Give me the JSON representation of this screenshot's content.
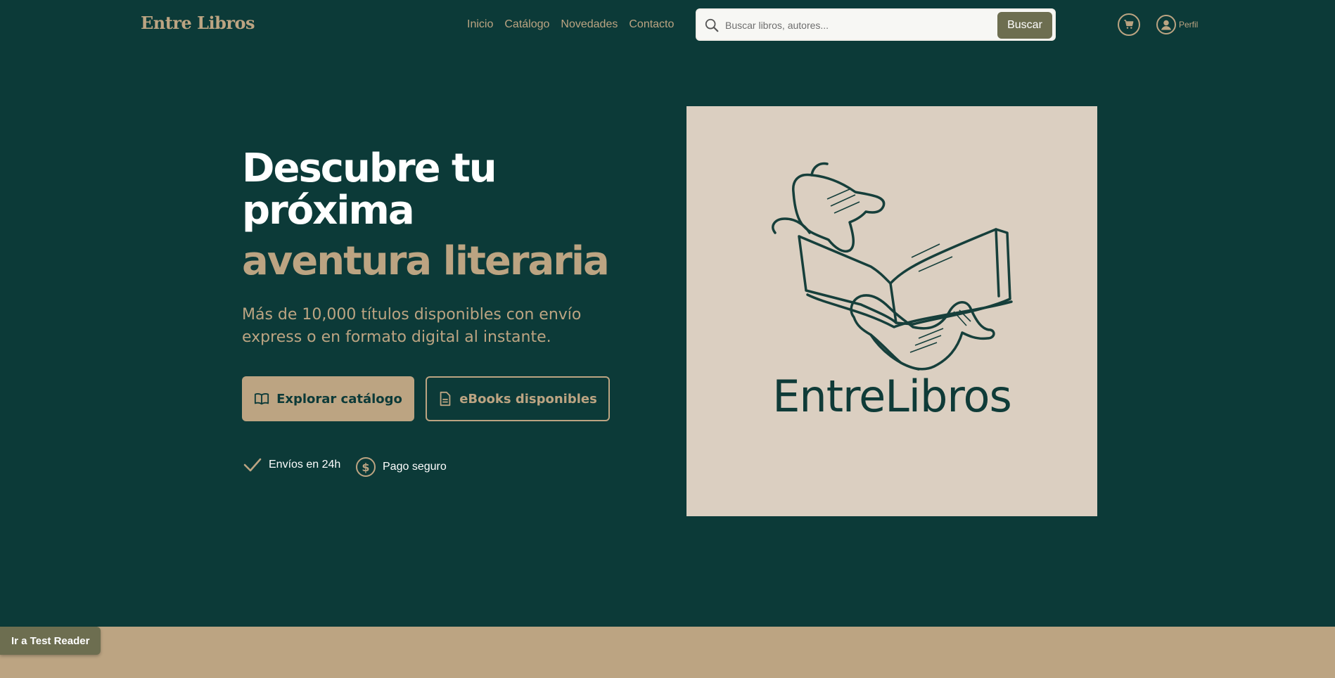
{
  "header": {
    "logo": "Entre Libros",
    "nav": [
      "Inicio",
      "Catálogo",
      "Novedades",
      "Contacto"
    ],
    "search": {
      "placeholder": "Buscar libros, autores...",
      "button": "Buscar"
    },
    "profile_label": "Perfil"
  },
  "hero": {
    "title_line1": "Descubre tu próxima",
    "title_line2": "aventura literaria",
    "subtitle": "Más de 10,000 títulos disponibles con envío express o en formato digital al instante.",
    "primary_button": "Explorar catálogo",
    "secondary_button": "eBooks disponibles",
    "features": [
      {
        "icon": "check-icon",
        "label": "Envíos en 24h"
      },
      {
        "icon": "dollar-coin-icon",
        "label": "Pago seguro"
      }
    ],
    "image_wordmark": "EntreLibros"
  },
  "floating": {
    "test_reader": "Ir a Test Reader"
  },
  "colors": {
    "background": "#0c3a38",
    "accent": "#bca482",
    "button_dark": "#6d6e50",
    "image_bg": "#dbcfc1"
  }
}
